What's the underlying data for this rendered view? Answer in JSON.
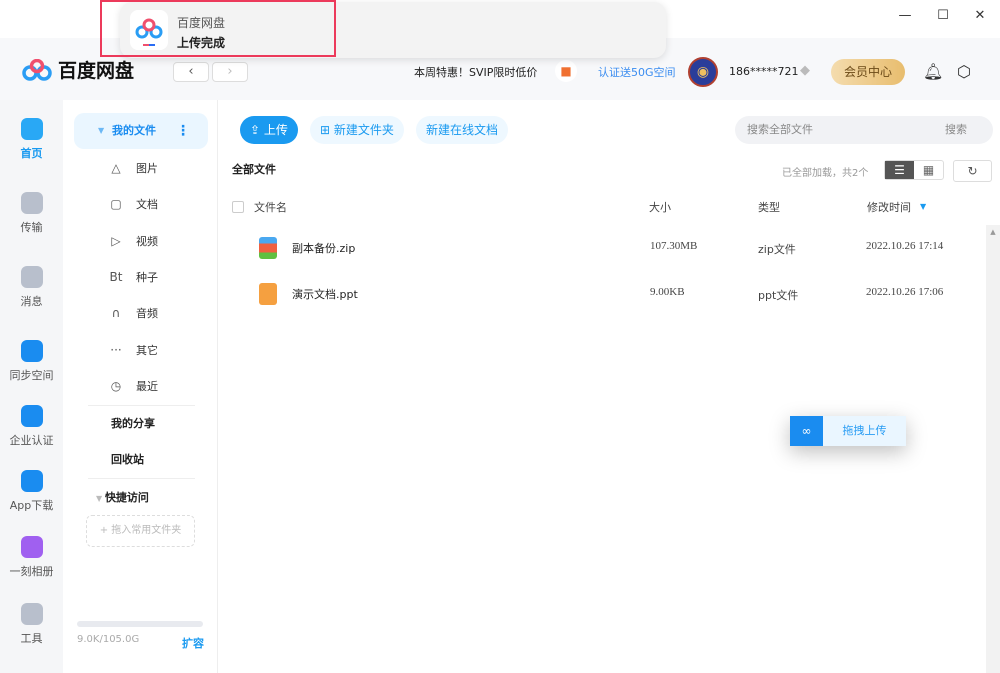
{
  "window": {
    "minimize": "—",
    "maximize": "☐",
    "close": "✕"
  },
  "notification": {
    "app_name": "百度网盘",
    "message": "上传完成"
  },
  "header": {
    "logo_text": "百度网盘",
    "back": "‹",
    "forward": "›",
    "promo": "本周特惠！SVIP限时低价",
    "cert_link": "认证送50G空间",
    "username": "186*****721",
    "vip_button": "会员中心",
    "icons": [
      "gift-icon",
      "diamond-icon",
      "bell-icon",
      "settings-icon"
    ]
  },
  "rail": [
    {
      "label": "首页",
      "active": true
    },
    {
      "label": "传输"
    },
    {
      "label": "消息"
    },
    {
      "label": "同步空间"
    },
    {
      "label": "企业认证"
    },
    {
      "label": "App下载"
    },
    {
      "label": "一刻相册"
    },
    {
      "label": "工具"
    }
  ],
  "sidebar": {
    "my_files": "我的文件",
    "categories": [
      {
        "icon": "△",
        "label": "图片"
      },
      {
        "icon": "▢",
        "label": "文档"
      },
      {
        "icon": "▷",
        "label": "视频"
      },
      {
        "icon": "Bt",
        "label": "种子"
      },
      {
        "icon": "∩",
        "label": "音频"
      },
      {
        "icon": "···",
        "label": "其它"
      },
      {
        "icon": "◷",
        "label": "最近"
      }
    ],
    "my_share": "我的分享",
    "recycle": "回收站",
    "quick_access": "快捷访问",
    "drop_folder": "+ 拖入常用文件夹",
    "quota": "9.0K/105.0G",
    "quota_used_fraction": 0.0,
    "expand": "扩容"
  },
  "toolbar": {
    "upload": "上传",
    "new_folder": "新建文件夹",
    "new_doc": "新建在线文档",
    "search_placeholder": "搜索全部文件",
    "search_button": "搜索"
  },
  "main": {
    "title": "全部文件",
    "status": "已全部加载，共2个",
    "columns": [
      "文件名",
      "大小",
      "类型",
      "修改时间"
    ],
    "files": [
      {
        "name": "副本备份.zip",
        "size": "107.30MB",
        "type": "zip文件",
        "modified": "2022.10.26 17:14",
        "icon": "zip"
      },
      {
        "name": "演示文档.ppt",
        "size": "9.00KB",
        "type": "ppt文件",
        "modified": "2022.10.26 17:06",
        "icon": "ppt"
      }
    ]
  },
  "drag_upload": "拖拽上传",
  "colors": {
    "accent": "#1a9af0",
    "highlight": "#ec3a5b"
  }
}
